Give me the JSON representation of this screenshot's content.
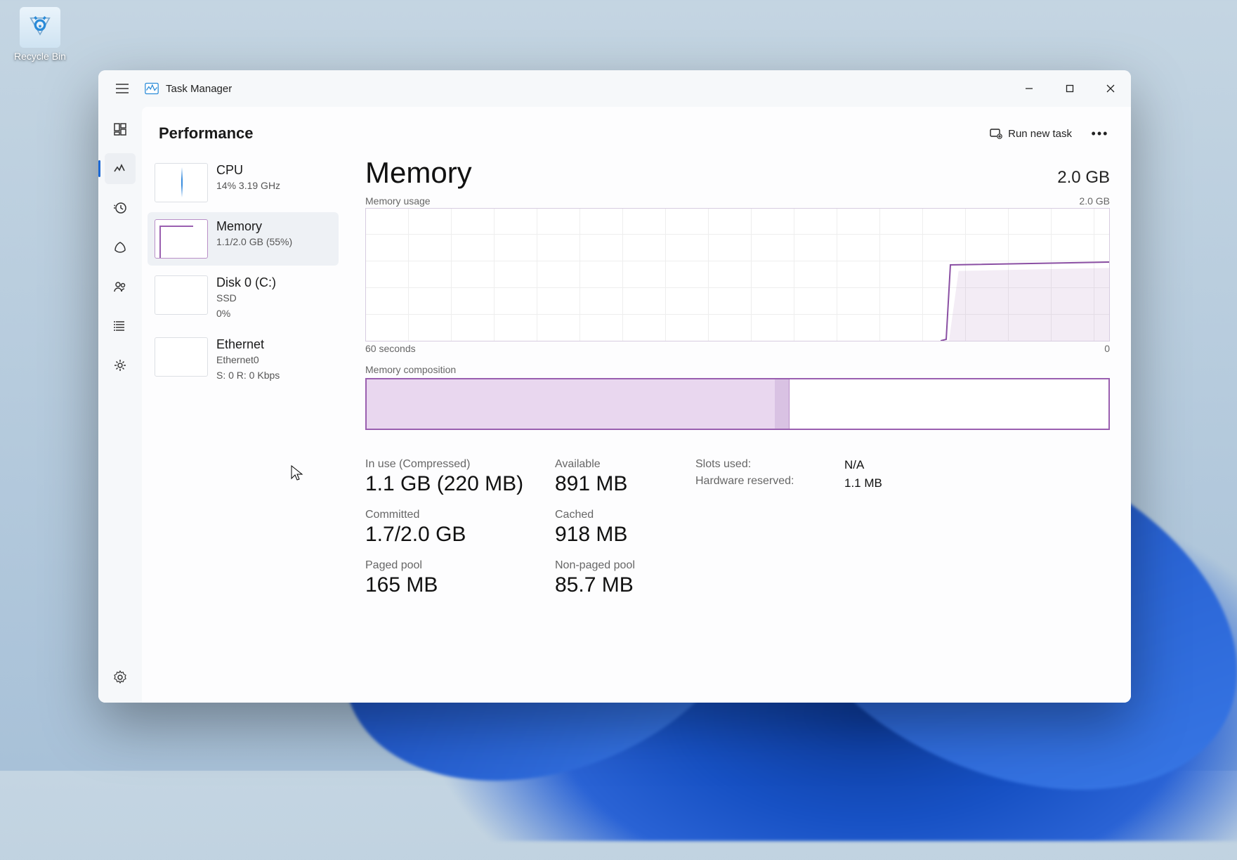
{
  "desktop": {
    "recycle_bin_label": "Recycle Bin"
  },
  "window": {
    "app_title": "Task Manager",
    "page_title": "Performance",
    "run_new_task_label": "Run new task"
  },
  "nav": {
    "processes": "Processes",
    "performance": "Performance",
    "history": "App history",
    "startup": "Startup apps",
    "users": "Users",
    "details": "Details",
    "services": "Services",
    "settings": "Settings"
  },
  "perf_list": {
    "cpu": {
      "name": "CPU",
      "sub": "14%  3.19 GHz"
    },
    "memory": {
      "name": "Memory",
      "sub": "1.1/2.0 GB (55%)"
    },
    "disk": {
      "name": "Disk 0 (C:)",
      "sub1": "SSD",
      "sub2": "0%"
    },
    "ethernet": {
      "name": "Ethernet",
      "sub1": "Ethernet0",
      "sub2": "S: 0  R: 0 Kbps"
    }
  },
  "detail": {
    "title": "Memory",
    "total": "2.0 GB",
    "usage_label": "Memory usage",
    "usage_max": "2.0 GB",
    "x_left": "60 seconds",
    "x_right": "0",
    "composition_label": "Memory composition",
    "composition": {
      "in_use_pct": 55,
      "modified_pct": 2
    },
    "stats": {
      "in_use": {
        "label": "In use (Compressed)",
        "value": "1.1 GB (220 MB)"
      },
      "available": {
        "label": "Available",
        "value": "891 MB"
      },
      "committed": {
        "label": "Committed",
        "value": "1.7/2.0 GB"
      },
      "cached": {
        "label": "Cached",
        "value": "918 MB"
      },
      "paged": {
        "label": "Paged pool",
        "value": "165 MB"
      },
      "nonpaged": {
        "label": "Non-paged pool",
        "value": "85.7 MB"
      }
    },
    "info": {
      "slots": {
        "label": "Slots used:",
        "value": "N/A"
      },
      "hw_reserved": {
        "label": "Hardware reserved:",
        "value": "1.1 MB"
      }
    }
  },
  "chart_data": {
    "type": "line",
    "title": "Memory usage",
    "xlabel": "seconds ago",
    "ylabel": "GB",
    "ylim": [
      0,
      2.0
    ],
    "xlim": [
      60,
      0
    ],
    "series": [
      {
        "name": "Memory",
        "x": [
          60,
          16,
          14,
          12,
          10,
          8,
          6,
          4,
          2,
          0
        ],
        "values": [
          0,
          0,
          0.05,
          1.05,
          1.1,
          1.1,
          1.1,
          1.1,
          1.1,
          1.1
        ]
      }
    ]
  }
}
